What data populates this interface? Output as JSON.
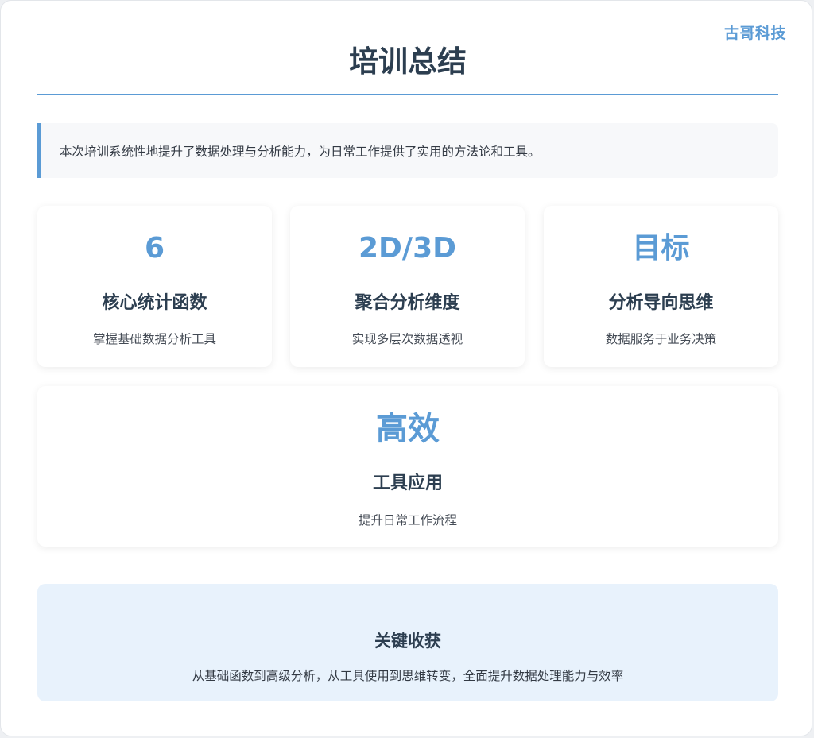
{
  "brand": "古哥科技",
  "title": "培训总结",
  "intro": "本次培训系统性地提升了数据处理与分析能力，为日常工作提供了实用的方法论和工具。",
  "cards": [
    {
      "value": "6",
      "label": "核心统计函数",
      "desc": "掌握基础数据分析工具"
    },
    {
      "value": "2D/3D",
      "label": "聚合分析维度",
      "desc": "实现多层次数据透视"
    },
    {
      "value": "目标",
      "label": "分析导向思维",
      "desc": "数据服务于业务决策"
    },
    {
      "value": "高效",
      "label": "工具应用",
      "desc": "提升日常工作流程"
    }
  ],
  "takeaway": {
    "title": "关键收获",
    "desc": "从基础函数到高级分析，从工具使用到思维转变，全面提升数据处理能力与效率"
  },
  "colors": {
    "accent": "#5b9bd5",
    "heading": "#2c3e50",
    "takeaway_bg": "#e8f2fc"
  }
}
